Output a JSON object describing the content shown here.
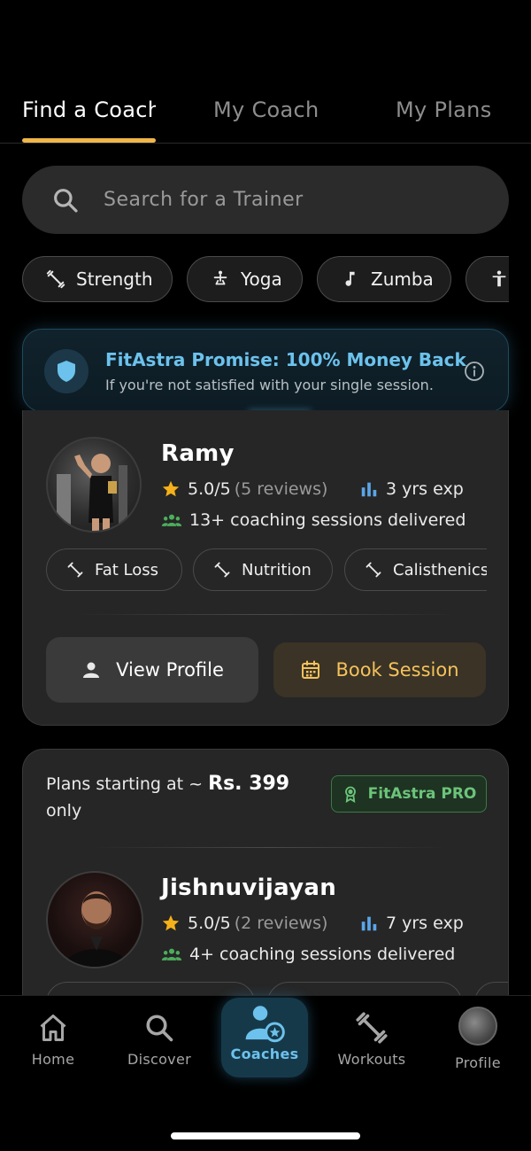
{
  "tabs": [
    {
      "label": "Find a Coach"
    },
    {
      "label": "My Coach"
    },
    {
      "label": "My Plans"
    }
  ],
  "search": {
    "placeholder": "Search for a Trainer"
  },
  "categories": [
    {
      "label": "Strength",
      "icon": "dumbbell-icon"
    },
    {
      "label": "Yoga",
      "icon": "yoga-icon"
    },
    {
      "label": "Zumba",
      "icon": "music-note-icon"
    },
    {
      "label": "",
      "icon": "person-icon"
    }
  ],
  "promise": {
    "title": "FitAstra Promise: 100% Money Back",
    "subtitle": "If you're not satisfied with your single session."
  },
  "coaches": [
    {
      "name": "Ramy",
      "rating": "5.0/5",
      "reviews": "(5 reviews)",
      "experience": "3 yrs exp",
      "sessions": "13+ coaching sessions delivered",
      "specialties": [
        "Fat Loss",
        "Nutrition",
        "Calisthenics"
      ],
      "view_label": "View Profile",
      "book_label": "Book Session"
    },
    {
      "plans_prefix": "Plans starting at ~ ",
      "plans_price": "Rs. 399",
      "plans_suffix": "only",
      "badge": "FitAstra PRO",
      "name": "Jishnuvijayan",
      "rating": "5.0/5",
      "reviews": "(2 reviews)",
      "experience": "7 yrs exp",
      "sessions": "4+ coaching sessions delivered"
    }
  ],
  "nav": [
    {
      "label": "Home",
      "icon": "home-icon"
    },
    {
      "label": "Discover",
      "icon": "search-icon"
    },
    {
      "label": "Coaches",
      "icon": "coach-icon"
    },
    {
      "label": "Workouts",
      "icon": "dumbbell-icon"
    },
    {
      "label": "Profile",
      "icon": "avatar"
    }
  ],
  "colors": {
    "accent": "#f0b64a",
    "promise": "#6cc2ec",
    "pro_green": "#6cc47a",
    "star": "#f5b01a"
  }
}
